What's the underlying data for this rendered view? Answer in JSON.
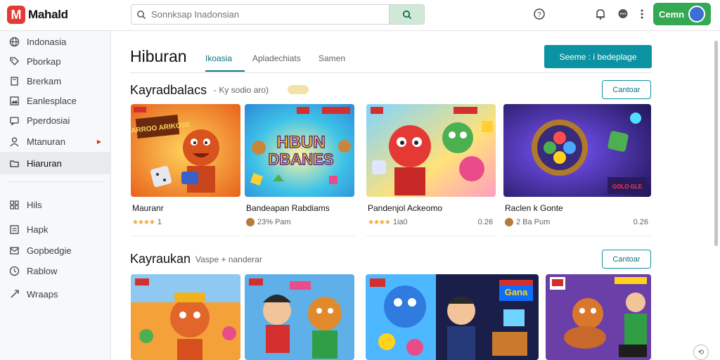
{
  "app": {
    "logo_letter": "M",
    "logo_text": "Mahald"
  },
  "search": {
    "placeholder": "Sonnksap Inadonsian"
  },
  "account": {
    "label": "Cemn"
  },
  "sidebar": {
    "items": [
      {
        "label": "Indonasia",
        "icon": "globe-icon"
      },
      {
        "label": "Pborkap",
        "icon": "tag-icon"
      },
      {
        "label": "Brerkam",
        "icon": "book-icon"
      },
      {
        "label": "Eanlesplace",
        "icon": "image-icon"
      },
      {
        "label": "Pperdosiai",
        "icon": "message-icon"
      },
      {
        "label": "Mtanuran",
        "icon": "user-icon"
      },
      {
        "label": "Hiaruran",
        "icon": "folder-icon"
      },
      {
        "label": "Hils",
        "icon": "grid-icon"
      },
      {
        "label": "Hapk",
        "icon": "list-icon"
      },
      {
        "label": "Gopbedgie",
        "icon": "mail-icon"
      },
      {
        "label": "Rablow",
        "icon": "clock-icon"
      },
      {
        "label": "Wraaps",
        "icon": "tag2-icon"
      }
    ]
  },
  "main": {
    "title": "Hiburan",
    "tabs": [
      {
        "label": "Ikoasia"
      },
      {
        "label": "Apladechiats"
      },
      {
        "label": "Samen"
      }
    ],
    "primary_button": "Seeme  : i bedeplage"
  },
  "sections": [
    {
      "title": "Kayradbalacs",
      "subtitle": "- Ky sodio aro)",
      "button": "Cantoar",
      "cards": [
        {
          "name": "Mauranr",
          "meta": "1",
          "price": "",
          "meta_type": "stars"
        },
        {
          "name": "Bandeapan Rabdiams",
          "meta": "23% Pam",
          "price": "",
          "meta_type": "avatar"
        },
        {
          "name": "Pandenjol Ackeomo",
          "meta": "1ia0",
          "price": "0.26",
          "meta_type": "stars"
        },
        {
          "name": "Raclen k Gonte",
          "meta": "2 Ba Pum",
          "price": "0.26",
          "meta_type": "avatar"
        }
      ]
    },
    {
      "title": "Kayraukan",
      "subtitle": "Vaspe + nanderar",
      "button": "Cantoar",
      "cards": []
    }
  ],
  "thumb_texts": {
    "t1": "WARROO ARIKOSE",
    "t2_line1": "HBUN",
    "t2_line2": "DBANES",
    "t4": "GOLO GLE"
  },
  "colors": {
    "accent": "#0b93a3",
    "logo": "#e53935",
    "account": "#34a853"
  }
}
